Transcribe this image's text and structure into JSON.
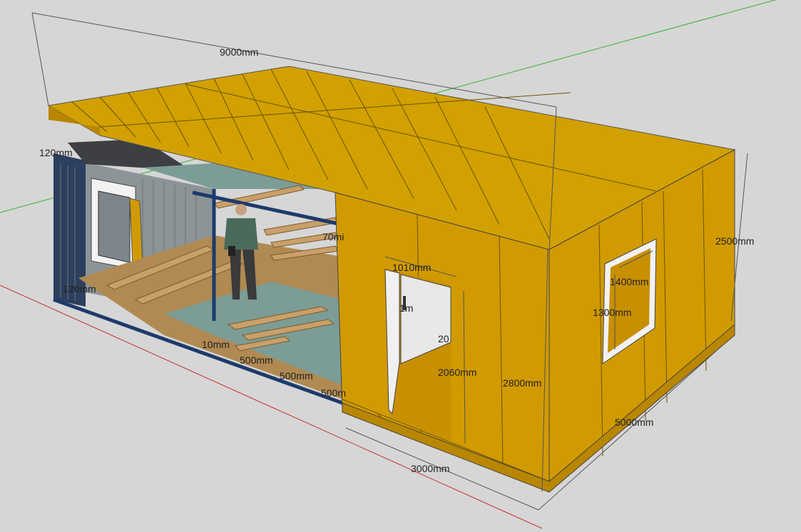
{
  "colors": {
    "background": "#d6d6d6",
    "panel": "#d19a00",
    "panel_dark": "#b98600",
    "roof": "#d2a000",
    "container_wall": "#8d9497",
    "floor_wood": "#b08a52",
    "floor_teal": "#7c9c96",
    "frame_blue": "#1d3a6b",
    "axis_green": "#34b234",
    "axis_red": "#c83030"
  },
  "dimensions": {
    "overall_length": "9000mm",
    "short_width": "3000mm",
    "depth": "5000mm",
    "height": "2500mm",
    "door_width": "1010mm",
    "door_height": "2060mm",
    "wall_height": "2800mm",
    "window_width": "1400mm",
    "window_height": "1300mm",
    "small_120_top": "120mm",
    "small_120_left": "120mm",
    "small_70": "70mi",
    "small_10": "10mm",
    "small_500_a": "500mm",
    "small_500_b": "500mm",
    "small_500_c": "500m",
    "small_1m": "1m",
    "small_20": "20"
  },
  "icons": {
    "person": "person-figure-icon"
  }
}
